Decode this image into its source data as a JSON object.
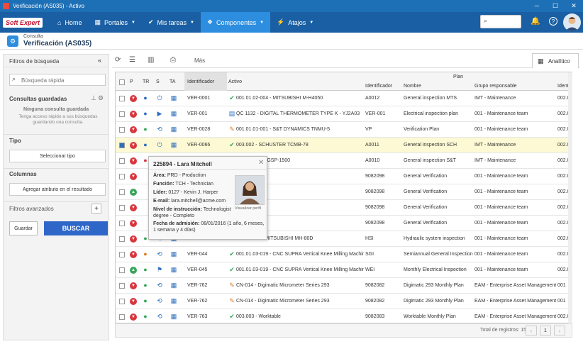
{
  "window": {
    "title": "Verificación (AS035) - Activo"
  },
  "nav": {
    "logo": "Soft Expert",
    "home": "Home",
    "portals": "Portales",
    "tasks": "Mis tareas",
    "components": "Componentes",
    "shortcuts": "Atajos"
  },
  "breadcrumb": {
    "sub": "Consulta",
    "title": "Verificación (AS035)"
  },
  "sidebar": {
    "header": "Filtros de búsqueda",
    "quick_search_placeholder": "Búsqueda rápida",
    "saved_title": "Consultas guardadas",
    "none": "Ninguna consulta guardada",
    "none_desc": "Tenga acceso rápido a sus búsquedas guardando una consulta.",
    "type_title": "Tipo",
    "select_type": "Seleccionar tipo",
    "columns_title": "Columnas",
    "add_attr": "Agregar atributo en el resultado",
    "advanced": "Filtros avanzados",
    "save": "Guardar",
    "search": "BUSCAR"
  },
  "toolbar": {
    "more": "Más",
    "analytic": "Analítico"
  },
  "grid": {
    "plan_group": "Plan",
    "headers": {
      "p": "P",
      "tr": "TR",
      "s": "S",
      "ta": "TA",
      "id": "Identificador",
      "active": "Activo",
      "plan_id": "Identificador",
      "name": "Nombre",
      "group": "Grupo responsable",
      "ident2": "Identi"
    },
    "rows": [
      {
        "id": "VER-0001",
        "active": "001.01.02-004 - MITSUBISHI M-H4050",
        "pid": "A0012",
        "name": "General inspection MTS",
        "group": "IMT - Maintenance",
        "i2": "002.0",
        "p": "red",
        "tr": "blue",
        "s": "power",
        "aicon": "check"
      },
      {
        "id": "VER-001",
        "active": "QC 1132 - DIGITAL THERMOMETER TYPE K - YJ2A03",
        "pid": "VER-001",
        "name": "Electrical inspection plan",
        "group": "001 - Maintenance team",
        "i2": "002.0",
        "p": "red",
        "tr": "blue",
        "s": "play",
        "aicon": "doc"
      },
      {
        "id": "VER-0028",
        "active": "001.01.01-001 - S&T DYNAMICS TNMU-5",
        "pid": "VP",
        "name": "Verification Plan",
        "group": "001 - Maintenance team",
        "i2": "002.0",
        "p": "red",
        "tr": "green",
        "s": "cycle",
        "aicon": "wrench"
      },
      {
        "id": "VER-0066",
        "active": "003.002 - SCHUSTER TCMB-78",
        "pid": "A0011",
        "name": "General inspection SCH",
        "group": "IMT - Maintenance",
        "i2": "002.0",
        "p": "red",
        "tr": "blue",
        "s": "power",
        "aicon": "check",
        "sel": true
      },
      {
        "id": "VER-",
        "active": "S&T DYNAMICS GSP-1500",
        "pid": "A0010",
        "name": "General inspection S&T",
        "group": "IMT - Maintenance",
        "i2": "002.0",
        "p": "red",
        "tr": "red",
        "s": "power",
        "aicon": "none"
      },
      {
        "id": "",
        "active": "Screw Extruder",
        "pid": "9082098",
        "name": "General Verification",
        "group": "001 - Maintenance team",
        "i2": "002.0",
        "p": "red",
        "tr": "",
        "s": "",
        "aicon": "none"
      },
      {
        "id": "",
        "active": "Screw Extruder",
        "pid": "9082098",
        "name": "General Verification",
        "group": "001 - Maintenance team",
        "i2": "002.0",
        "p": "green",
        "tr": "",
        "s": "",
        "aicon": "none"
      },
      {
        "id": "",
        "active": "Screw Extruder",
        "pid": "9082098",
        "name": "General Verification",
        "group": "001 - Maintenance team",
        "i2": "002.0",
        "p": "red",
        "tr": "",
        "s": "",
        "aicon": "none"
      },
      {
        "id": "",
        "active": "Screw Extruder",
        "pid": "9082098",
        "name": "General Verification",
        "group": "001 - Maintenance team",
        "i2": "002.0",
        "p": "red",
        "tr": "",
        "s": "",
        "aicon": "none"
      },
      {
        "id": "VER-039",
        "active": "001.01.02-005 - MITSUBISHI MH-80D",
        "pid": "HSI",
        "name": "Hydraulic system inspection",
        "group": "001 - Maintenance team",
        "i2": "002.0",
        "p": "red",
        "tr": "green",
        "s": "cycle",
        "aicon": "none"
      },
      {
        "id": "VER-044",
        "active": "001.01.03-019 - CNC SUPRA Vertical Knee Milling Machine",
        "pid": "SGI",
        "name": "Semiannual General Inspection",
        "group": "001 - Maintenance team",
        "i2": "002.0",
        "p": "red",
        "tr": "orange",
        "s": "cycle",
        "aicon": "check"
      },
      {
        "id": "VER-045",
        "active": "001.01.03-019 - CNC SUPRA Vertical Knee Milling Machine",
        "pid": "WEI",
        "name": "Monthly Electrical Inspection",
        "group": "001 - Maintenance team",
        "i2": "002.0",
        "p": "green",
        "tr": "green",
        "s": "flag",
        "aicon": "check"
      },
      {
        "id": "VER-762",
        "active": "CN-014 - Digimatic Micrometer Series 293",
        "pid": "9082082",
        "name": "Digimatic 293 Monthly Plan",
        "group": "EAM - Enterprise Asset Management",
        "i2": "001",
        "p": "red",
        "tr": "green",
        "s": "cycle",
        "aicon": "wrench"
      },
      {
        "id": "VER-762",
        "active": "CN-014 - Digimatic Micrometer Series 293",
        "pid": "9082082",
        "name": "Digimatic 293 Monthly Plan",
        "group": "EAM - Enterprise Asset Management",
        "i2": "001",
        "p": "red",
        "tr": "green",
        "s": "cycle",
        "aicon": "wrench"
      },
      {
        "id": "VER-763",
        "active": "003.003 - Worktable",
        "pid": "9082083",
        "name": "Worktable Monthly Plan",
        "group": "EAM - Enterprise Asset Management",
        "i2": "002.0",
        "p": "red",
        "tr": "green",
        "s": "cycle",
        "aicon": "check"
      }
    ]
  },
  "popup": {
    "title": "225894 - Lara Mitchell",
    "area_l": "Área:",
    "area": "PRD - Production",
    "func_l": "Función:",
    "func": "TCH - Technician",
    "leader_l": "Líder:",
    "leader": "0127 - Kevin J. Harper",
    "email_l": "E-mail:",
    "email": "lara.mitchell@acme.com",
    "edu_l": "Nivel de instrucción:",
    "edu": "Technologist degree - Completo",
    "adm_l": "Fecha de admisión:",
    "adm": "08/01/2016 (1 año, 6 meses, 1 semana y 4 días)",
    "view": "Visualizar perfil"
  },
  "footer": {
    "total": "Total de registros: 15",
    "page": "1"
  },
  "colors": {
    "accent": "#2d8ee0",
    "red": "#d9363e",
    "green": "#3aa55c",
    "blue": "#2d6fbf"
  }
}
